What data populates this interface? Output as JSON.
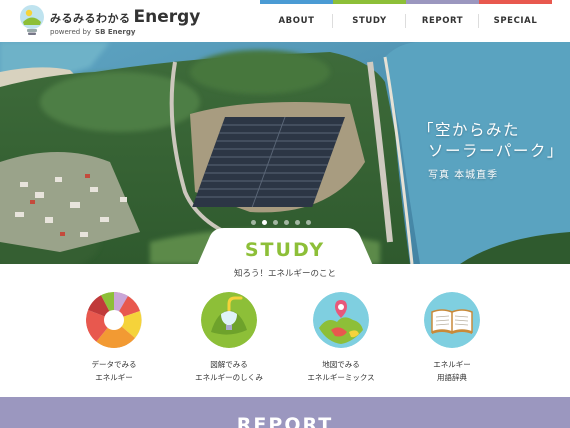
{
  "header": {
    "logo_jp": "みるみるわかる",
    "logo_en": "Energy",
    "logo_powered": "powered by",
    "logo_sb": "SB Energy"
  },
  "nav": {
    "items": [
      {
        "label": "ABOUT",
        "color": "#4a9bd4"
      },
      {
        "label": "STUDY",
        "color": "#8dbf38"
      },
      {
        "label": "REPORT",
        "color": "#9b97bf"
      },
      {
        "label": "SPECIAL",
        "color": "#e8584e"
      }
    ]
  },
  "hero": {
    "caption_line1": "「空からみた",
    "caption_line2": "ソーラーパーク」",
    "credit": "写真 本城直季",
    "slides": 6,
    "active_slide": 1
  },
  "study": {
    "title": "STUDY",
    "subtitle": "知ろう！エネルギーのこと",
    "accent": "#8dbf38",
    "items": [
      {
        "line1": "データでみる",
        "line2": "エネルギー",
        "icon": "pie-chart-icon"
      },
      {
        "line1": "図解でみる",
        "line2": "エネルギーのしくみ",
        "icon": "lightbulb-plug-icon"
      },
      {
        "line1": "地図でみる",
        "line2": "エネルギーミックス",
        "icon": "map-pin-icon"
      },
      {
        "line1": "エネルギー",
        "line2": "用語辞典",
        "icon": "open-book-icon"
      }
    ]
  },
  "report": {
    "title": "REPORT",
    "color": "#9b97bf"
  }
}
